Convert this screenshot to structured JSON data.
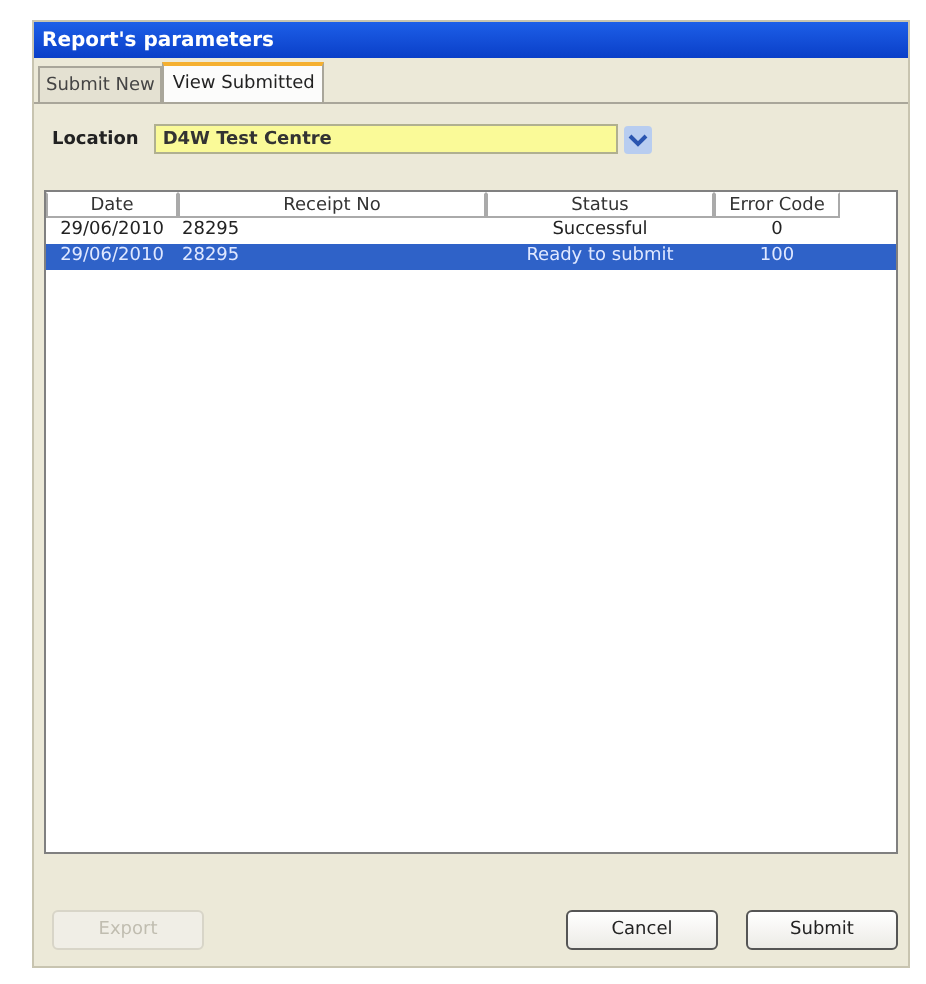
{
  "window": {
    "title": "Report's parameters"
  },
  "tabs": [
    {
      "label": "Submit New",
      "selected": false
    },
    {
      "label": "View Submitted",
      "selected": true
    }
  ],
  "location": {
    "label": "Location",
    "value": "D4W Test Centre"
  },
  "table": {
    "columns": [
      "Date",
      "Receipt No",
      "Status",
      "Error Code"
    ],
    "rows": [
      {
        "cells": [
          "29/06/2010",
          "28295",
          "Successful",
          "0"
        ],
        "selected": false
      },
      {
        "cells": [
          "29/06/2010",
          "28295",
          "Ready to submit",
          "100"
        ],
        "selected": true
      }
    ]
  },
  "buttons": [
    {
      "label": "Export",
      "disabled": true
    },
    {
      "label": "Cancel",
      "disabled": false
    },
    {
      "label": "Submit",
      "disabled": false
    }
  ]
}
